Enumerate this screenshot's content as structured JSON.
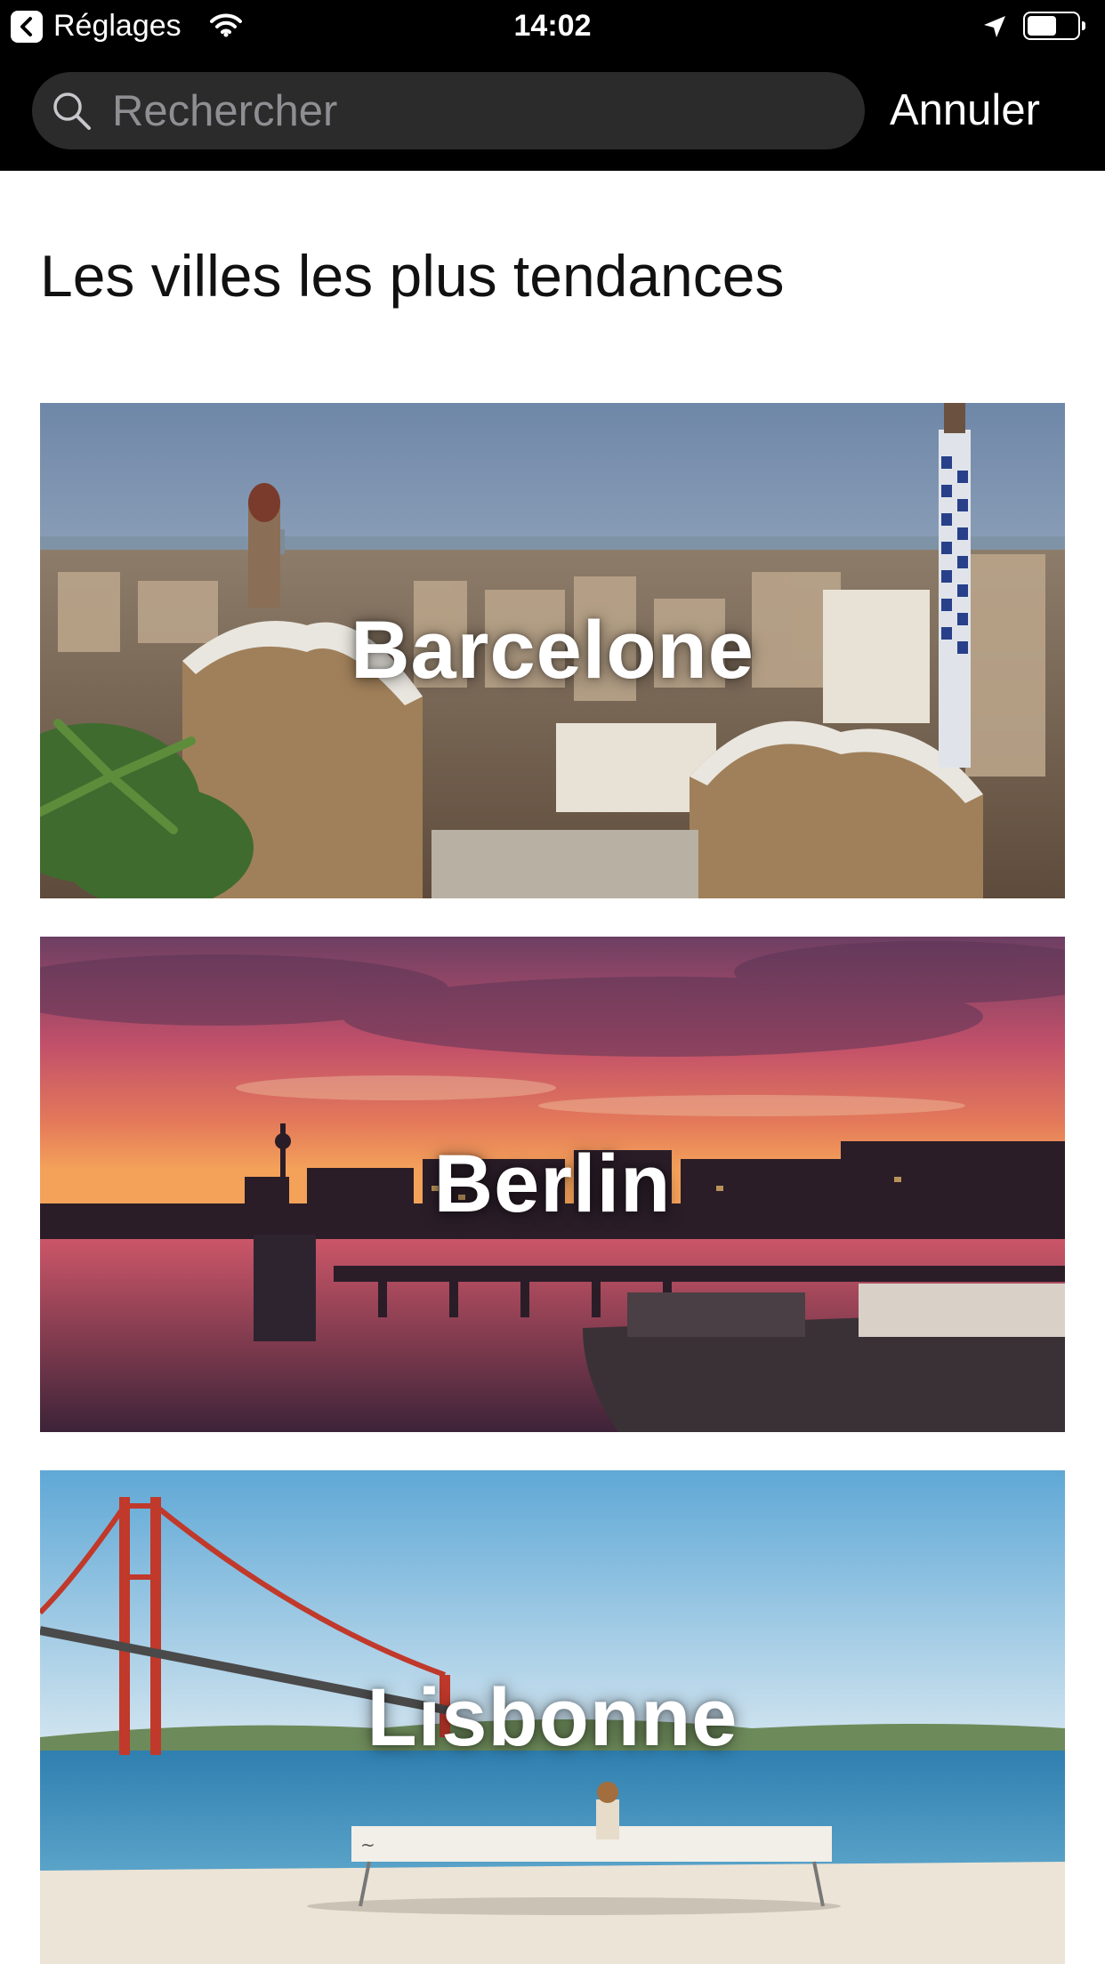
{
  "status_bar": {
    "back_label": "Réglages",
    "time": "14:02",
    "battery_level": 0.6
  },
  "search": {
    "placeholder": "Rechercher",
    "value": "",
    "cancel_label": "Annuler"
  },
  "section": {
    "title": "Les villes les plus tendances"
  },
  "cities": [
    {
      "name": "Barcelone"
    },
    {
      "name": "Berlin"
    },
    {
      "name": "Lisbonne"
    }
  ],
  "colors": {
    "status_bar_bg": "#000000",
    "search_field_bg": "#2b2b2b",
    "placeholder": "#8e8e93",
    "caret": "#4a90e2",
    "page_bg": "#ffffff"
  },
  "icons": [
    "back-arrow-icon",
    "wifi-icon",
    "location-arrow-icon",
    "battery-icon",
    "search-icon"
  ]
}
